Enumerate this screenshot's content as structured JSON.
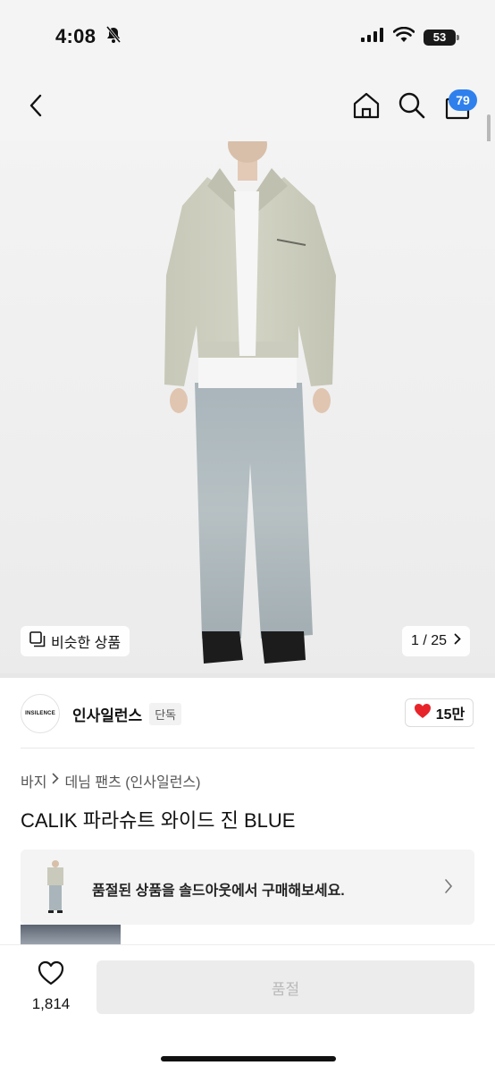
{
  "status_bar": {
    "time": "4:08",
    "battery": "53"
  },
  "nav": {
    "cart_count": "79"
  },
  "gallery": {
    "similar_label": "비슷한 상품",
    "page_indicator": "1 / 25"
  },
  "brand": {
    "logo_text": "INSILENCE",
    "name": "인사일런스",
    "exclusive": "단독",
    "likes": "15만"
  },
  "breadcrumb": {
    "category": "바지",
    "subcategory": "데님 팬츠 (인사일런스)"
  },
  "product": {
    "title": "CALIK 파라슈트 와이드 진 BLUE"
  },
  "soldout_banner": {
    "text": "품절된 상품을 솔드아웃에서 구매해보세요."
  },
  "bottom": {
    "wish_count": "1,814",
    "button_label": "품절"
  },
  "colors": {
    "accent": "#2f80ed",
    "heart": "#e8242b"
  }
}
